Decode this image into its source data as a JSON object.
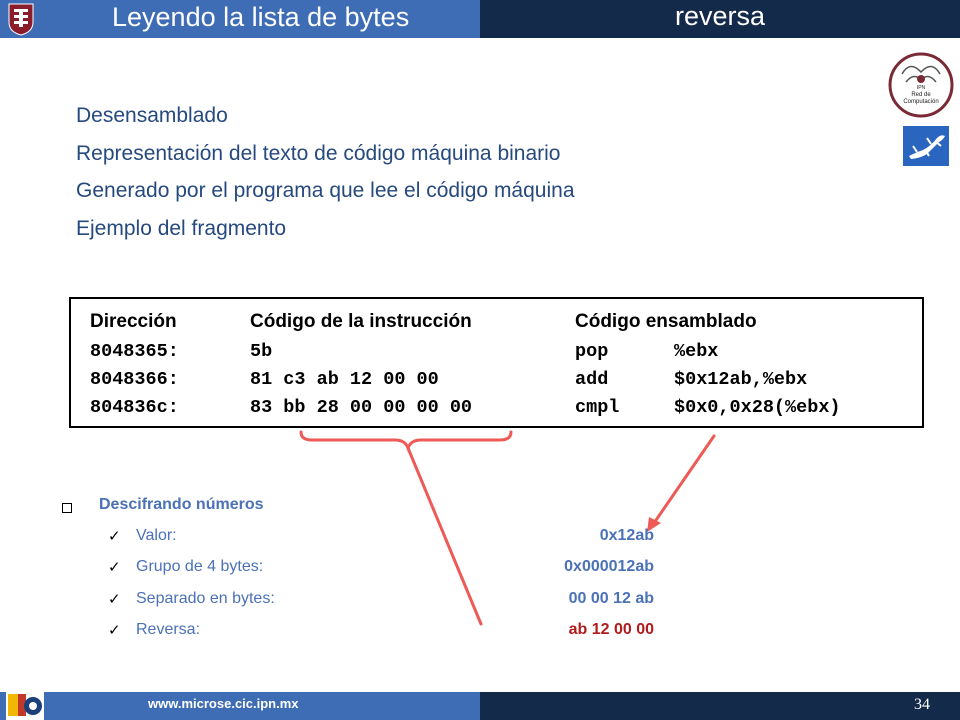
{
  "header": {
    "title": "Leyendo la lista de bytes",
    "subtitle": "reversa",
    "left_color": "#3e6db5",
    "right_color": "#142a4a"
  },
  "logos": {
    "top_left": "ipn-seal-icon",
    "red_badge": "red-de-computacion-logo",
    "red_badge_lines": [
      "IPN",
      "Red de",
      "Computación"
    ],
    "gecko": "gecko-icon",
    "footer": "cic-logo"
  },
  "bullets": [
    "Desensamblado",
    "Representación del texto de código máquina binario",
    "Generado por el programa que lee el código máquina",
    "Ejemplo del fragmento"
  ],
  "code_table": {
    "headers": [
      "Dirección",
      "Código de la instrucción",
      "Código ensamblado"
    ],
    "rows": [
      {
        "address": "8048365:",
        "bytes": "5b",
        "op": "pop",
        "args": "%ebx"
      },
      {
        "address": "8048366:",
        "bytes": "81 c3 ab 12 00 00",
        "op": "add",
        "args": "$0x12ab,%ebx"
      },
      {
        "address": "804836c:",
        "bytes": "83 bb 28 00 00 00 00",
        "op": "cmpl",
        "args": "$0x0,0x28(%ebx)"
      }
    ]
  },
  "decoding": {
    "title": "Descifrando números",
    "check_icon": "✓",
    "rows": [
      {
        "label": "Valor:",
        "value": "0x12ab"
      },
      {
        "label": "Grupo de 4 bytes:",
        "value": "0x000012ab"
      },
      {
        "label": "Separado en bytes:",
        "value": "00 00 12 ab"
      },
      {
        "label": "Reversa:",
        "value": "ab 12 00 00"
      }
    ],
    "accent_color": "#4b71b7",
    "highlight_color": "#b01c1c"
  },
  "annotation_color": "#ee5a55",
  "footer": {
    "url": "www.microse.cic.ipn.mx",
    "page_number": "34"
  }
}
